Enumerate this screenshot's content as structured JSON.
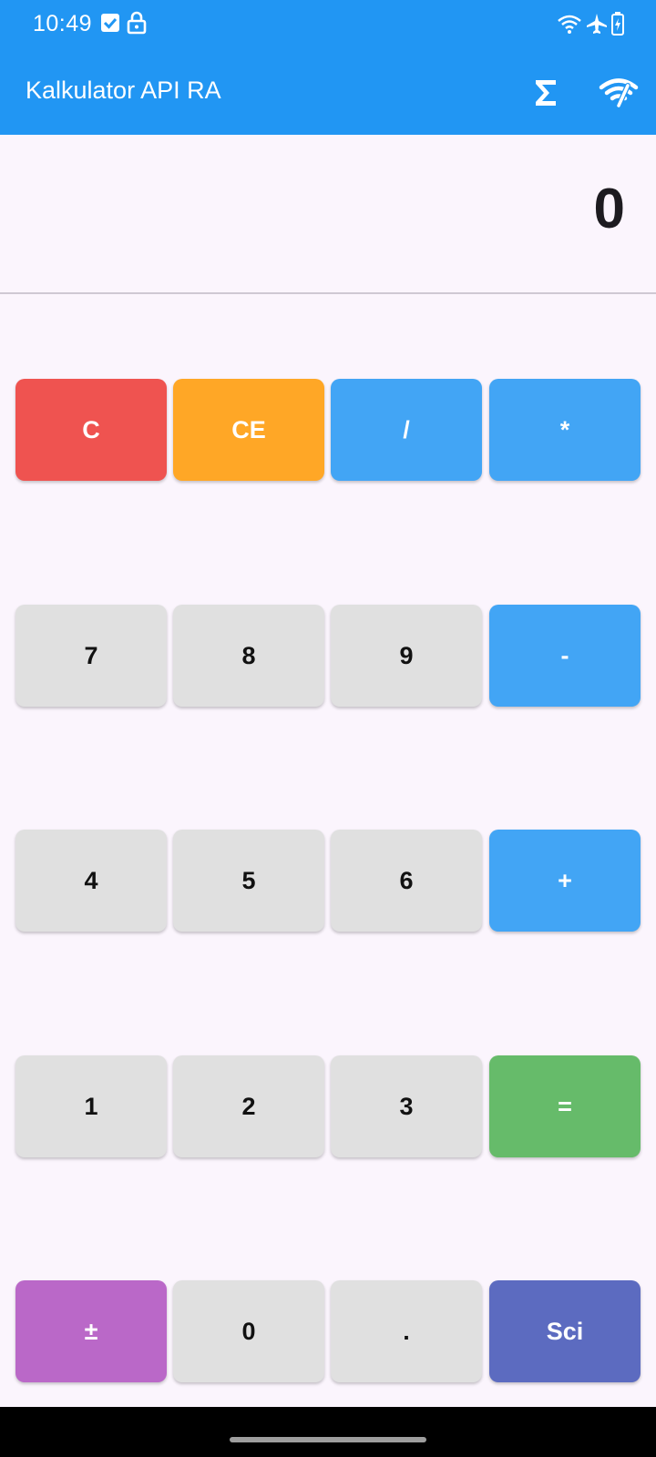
{
  "status_bar": {
    "time": "10:49",
    "left_icons": [
      "checkbox-notification-icon",
      "lock-icon"
    ],
    "right_icons": [
      "wifi-icon",
      "airplane-icon",
      "battery-charging-icon"
    ]
  },
  "app_bar": {
    "title": "Kalkulator API RA",
    "actions": [
      {
        "name": "sigma-icon",
        "glyph": "Σ"
      },
      {
        "name": "network-icon"
      }
    ]
  },
  "display": {
    "value": "0"
  },
  "keypad": {
    "rows": [
      [
        "C",
        "CE",
        "/",
        "*"
      ],
      [
        "7",
        "8",
        "9",
        "-"
      ],
      [
        "4",
        "5",
        "6",
        "+"
      ],
      [
        "1",
        "2",
        "3",
        "="
      ],
      [
        "±",
        "0",
        ".",
        "Sci"
      ]
    ]
  },
  "colors": {
    "primary": "#2196F3",
    "clear": "#EF5350",
    "clear_entry": "#FFA726",
    "operator": "#42A5F5",
    "equals": "#66BB6A",
    "sign": "#BA68C8",
    "scientific": "#5C6BC0",
    "digit": "#E0E0E0",
    "background": "#FBF5FD"
  }
}
